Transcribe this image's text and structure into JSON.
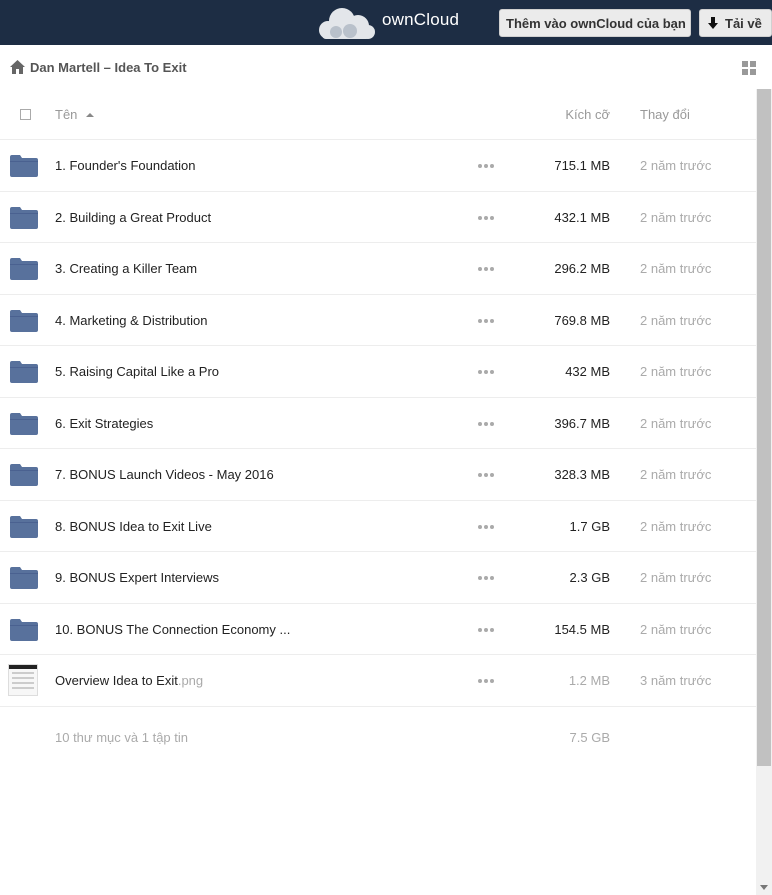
{
  "header": {
    "logo_text": "ownCloud",
    "add_button": "Thêm vào ownCloud của bạn",
    "download_button": "Tải về"
  },
  "breadcrumb": {
    "title": "Dan Martell – Idea To Exit"
  },
  "list_header": {
    "name": "Tên",
    "size": "Kích cỡ",
    "modified": "Thay đổi"
  },
  "files": [
    {
      "name": "1. Founder's Foundation",
      "ext": "",
      "size": "715.1 MB",
      "modified": "2 năm trước",
      "type": "folder"
    },
    {
      "name": "2. Building a Great Product",
      "ext": "",
      "size": "432.1 MB",
      "modified": "2 năm trước",
      "type": "folder"
    },
    {
      "name": "3. Creating a Killer Team",
      "ext": "",
      "size": "296.2 MB",
      "modified": "2 năm trước",
      "type": "folder"
    },
    {
      "name": "4. Marketing & Distribution",
      "ext": "",
      "size": "769.8 MB",
      "modified": "2 năm trước",
      "type": "folder"
    },
    {
      "name": "5. Raising Capital Like a Pro",
      "ext": "",
      "size": "432 MB",
      "modified": "2 năm trước",
      "type": "folder"
    },
    {
      "name": "6. Exit Strategies",
      "ext": "",
      "size": "396.7 MB",
      "modified": "2 năm trước",
      "type": "folder"
    },
    {
      "name": "7. BONUS Launch Videos - May 2016",
      "ext": "",
      "size": "328.3 MB",
      "modified": "2 năm trước",
      "type": "folder"
    },
    {
      "name": "8. BONUS Idea to Exit Live",
      "ext": "",
      "size": "1.7 GB",
      "modified": "2 năm trước",
      "type": "folder"
    },
    {
      "name": "9. BONUS Expert Interviews",
      "ext": "",
      "size": "2.3 GB",
      "modified": "2 năm trước",
      "type": "folder"
    },
    {
      "name": "10. BONUS The Connection Economy ...",
      "ext": "",
      "size": "154.5 MB",
      "modified": "2 năm trước",
      "type": "folder"
    },
    {
      "name": "Overview Idea to Exit",
      "ext": ".png",
      "size": "1.2 MB",
      "modified": "3 năm trước",
      "type": "image"
    }
  ],
  "summary": {
    "text": "10 thư mục và 1 tập tin",
    "total_size": "7.5 GB"
  },
  "colors": {
    "header_bg": "#1d2d44",
    "folder": "#58719c"
  }
}
